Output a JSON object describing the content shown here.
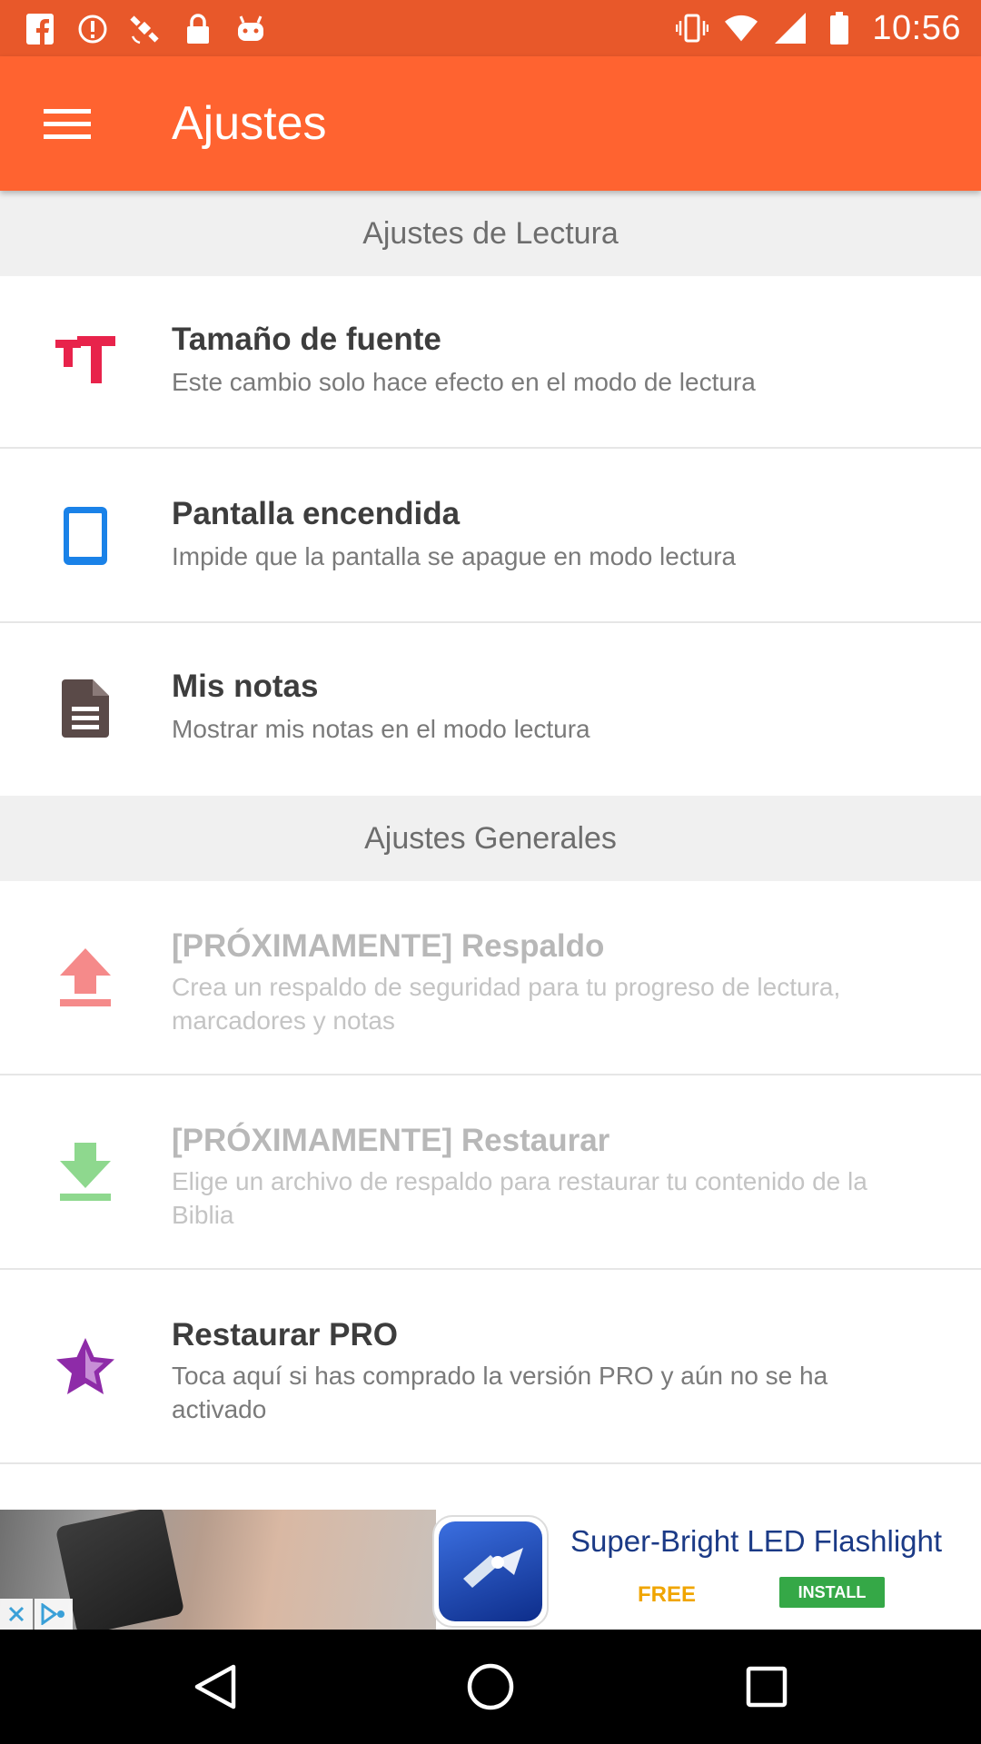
{
  "status_bar": {
    "time": "10:56",
    "left_icons": [
      "facebook-icon",
      "alert-icon",
      "satellite-icon",
      "lock-icon",
      "android-icon"
    ],
    "right_icons": [
      "vibrate-icon",
      "wifi-icon",
      "signal-icon",
      "battery-icon"
    ]
  },
  "app_bar": {
    "title": "Ajustes",
    "menu_icon": "hamburger-menu-icon",
    "color": "#ff6330"
  },
  "sections": [
    {
      "header": "Ajustes de Lectura",
      "items": [
        {
          "icon": "text-size-icon",
          "icon_color": "#e8234b",
          "title": "Tamaño de fuente",
          "description": "Este cambio solo hace efecto en el modo de lectura"
        },
        {
          "icon": "tablet-icon",
          "icon_color": "#1a82e8",
          "title": "Pantalla encendida",
          "description": "Impide que la pantalla se apague en modo lectura"
        },
        {
          "icon": "document-icon",
          "icon_color": "#5a4a48",
          "title": "Mis notas",
          "description": "Mostrar mis notas en el modo lectura"
        }
      ]
    },
    {
      "header": "Ajustes Generales",
      "items": [
        {
          "icon": "upload-icon",
          "icon_color": "#f58a8a",
          "title": "[PRÓXIMAMENTE] Respaldo",
          "description": "Crea un respaldo de seguridad para tu progreso de lectura, marcadores y notas",
          "disabled": true
        },
        {
          "icon": "download-icon",
          "icon_color": "#8ed88e",
          "title": "[PRÓXIMAMENTE] Restaurar",
          "description": "Elige un archivo de respaldo para restaurar tu contenido de la Biblia",
          "disabled": true
        },
        {
          "icon": "star-icon",
          "icon_color": "#8e2ba8",
          "title": "Restaurar PRO",
          "description": "Toca aquí si has comprado la versión PRO y aún no se ha activado"
        }
      ]
    }
  ],
  "ad": {
    "title": "Super-Bright LED Flashlight",
    "price": "FREE",
    "cta": "INSTALL"
  },
  "nav_bar": [
    "back-icon",
    "home-icon",
    "recents-icon"
  ]
}
